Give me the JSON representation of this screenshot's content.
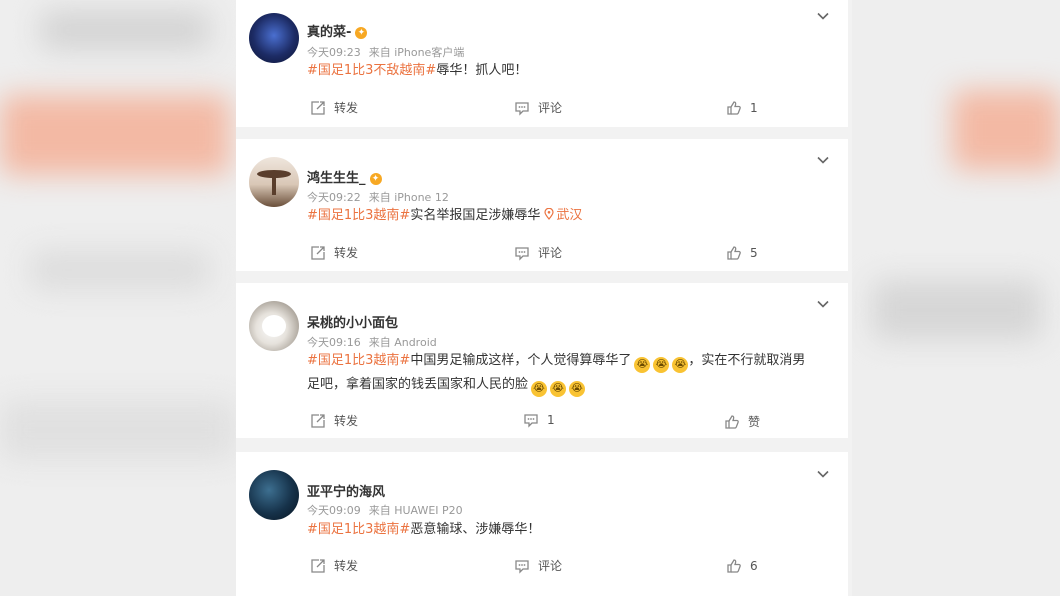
{
  "posts": [
    {
      "username": "真的菜-",
      "vip_badge": "✦",
      "time": "今天09:23",
      "source": "来自 iPhone客户端",
      "hashtag": "#国足1比3不敌越南#",
      "text": "辱华！抓人吧！",
      "repost_label": "转发",
      "comment_label": "评论",
      "like_label": "1"
    },
    {
      "username": "鸿生生生_",
      "vip_badge": "✦",
      "time": "今天09:22",
      "source": "来自 iPhone 12",
      "hashtag": "#国足1比3越南#",
      "text": "实名举报国足涉嫌辱华",
      "location": "武汉",
      "repost_label": "转发",
      "comment_label": "评论",
      "like_label": "5"
    },
    {
      "username": "呆桃的小小面包",
      "time": "今天09:16",
      "source": "来自 Android",
      "hashtag": "#国足1比3越南#",
      "text_line1": "中国男足输成这样，个人觉得算辱华了",
      "text_line1b": "，实在不行就取消男",
      "text_line2": "足吧，拿着国家的钱丢国家和人民的脸",
      "repost_label": "转发",
      "comment_label": "1",
      "like_label": "赞"
    },
    {
      "username": "亚平宁的海风",
      "time": "今天09:09",
      "source": "来自 HUAWEI P20",
      "hashtag": "#国足1比3越南#",
      "text": "恶意输球、涉嫌辱华！",
      "repost_label": "转发",
      "comment_label": "评论",
      "like_label": "6"
    }
  ],
  "emoji_glyph": "😭",
  "colors": {
    "hashtag": "#eb7340",
    "text": "#333333",
    "meta": "#999999",
    "vip": "#f7a823"
  },
  "icons": [
    "chevron-down-icon",
    "repost-icon",
    "comment-icon",
    "like-icon",
    "location-pin-icon",
    "vip-badge-icon",
    "crying-emoji-icon"
  ]
}
